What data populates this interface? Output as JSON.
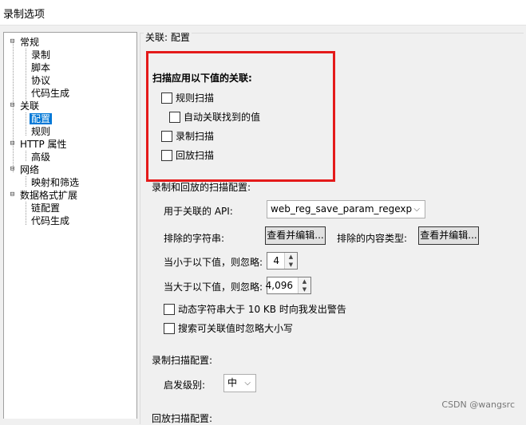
{
  "window": {
    "title": "录制选项"
  },
  "tree": {
    "items": [
      {
        "label": "常规",
        "toggle": "⊟"
      },
      {
        "label": "录制"
      },
      {
        "label": "脚本"
      },
      {
        "label": "协议"
      },
      {
        "label": "代码生成"
      },
      {
        "label": "关联",
        "toggle": "⊟"
      },
      {
        "label": "配置",
        "selected": true
      },
      {
        "label": "规则"
      },
      {
        "label": "HTTP 属性",
        "toggle": "⊟"
      },
      {
        "label": "高级"
      },
      {
        "label": "网络",
        "toggle": "⊟"
      },
      {
        "label": "映射和筛选"
      },
      {
        "label": "数据格式扩展",
        "toggle": "⊟"
      },
      {
        "label": "链配置"
      },
      {
        "label": "代码生成"
      }
    ]
  },
  "panel": {
    "title": "关联: 配置",
    "scan_section": {
      "heading": "扫描应用以下值的关联:",
      "opt_rules": "规则扫描",
      "opt_auto": "自动关联找到的值",
      "opt_record": "录制扫描",
      "opt_replay": "回放扫描"
    },
    "record_replay": {
      "heading": "录制和回放的扫描配置:",
      "api_label": "用于关联的 API:",
      "api_value": "web_reg_save_param_regexp",
      "exclude_strings_label": "排除的字符串:",
      "view_edit_1": "查看并编辑...",
      "exclude_content_label": "排除的内容类型:",
      "view_edit_2": "查看并编辑...",
      "min_label": "当小于以下值，则忽略:",
      "min_value": "4",
      "max_label": "当大于以下值，则忽略:",
      "max_value": "4,096",
      "warn_label": "动态字符串大于 10 KB 时向我发出警告",
      "ignore_case_label": "搜索可关联值时忽略大小写"
    },
    "record_scan": {
      "heading": "录制扫描配置:",
      "level_label": "启发级别:",
      "level_value": "中"
    },
    "replay_scan": {
      "heading": "回放扫描配置:"
    }
  },
  "watermark": "CSDN @wangsrc"
}
